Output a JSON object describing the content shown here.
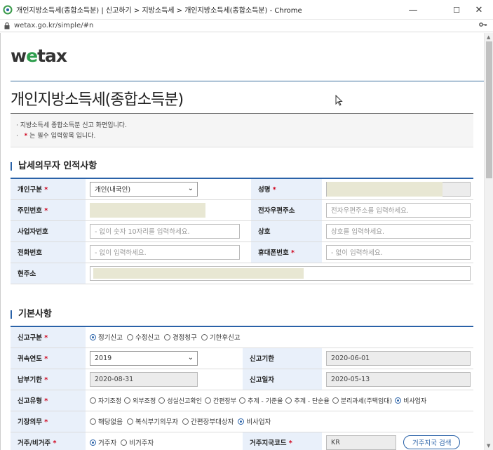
{
  "window": {
    "title": "개인지방소득세(종합소득분) | 신고하기 > 지방소득세 > 개인지방소득세(종합소득분) - Chrome",
    "url": "wetax.go.kr/simple/#n",
    "minimize": "—",
    "maximize": "☐",
    "close": "✕"
  },
  "logo": {
    "w": "w",
    "e": "e",
    "tax": "tax"
  },
  "page_title": "개인지방소득세(종합소득분)",
  "notice": {
    "line1": "· 지방소득세 종합소득분 신고 화면입니다.",
    "line2_prefix": "·",
    "line2_suffix": "는 필수 입력항목 입니다."
  },
  "required_mark": "*",
  "section1": {
    "title": "납세의무자 인적사항",
    "personal_type_label": "개인구분",
    "personal_type_value": "개인(내국인)",
    "name_label": "성명",
    "rrn_label": "주민번호",
    "email_label": "전자우편주소",
    "email_placeholder": "전자우편주소를 입력하세요.",
    "bizno_label": "사업자번호",
    "bizno_placeholder": "- 없이 숫자 10자리를 입력하세요.",
    "trade_name_label": "상호",
    "trade_name_placeholder": "상호를 입력하세요.",
    "phone_label": "전화번호",
    "phone_placeholder": "- 없이 입력하세요.",
    "mobile_label": "휴대폰번호",
    "mobile_placeholder": "- 없이 입력하세요.",
    "address_label": "현주소"
  },
  "section2": {
    "title": "기본사항",
    "report_type_label": "신고구분",
    "report_type_options": [
      "정기신고",
      "수정신고",
      "경정청구",
      "기한후신고"
    ],
    "report_type_selected": "정기신고",
    "year_label": "귀속연도",
    "year_value": "2019",
    "deadline_label": "신고기한",
    "deadline_value": "2020-06-01",
    "pay_deadline_label": "납부기한",
    "pay_deadline_value": "2020-08-31",
    "report_date_label": "신고일자",
    "report_date_value": "2020-05-13",
    "report_kind_label": "신고유형",
    "report_kind_options": [
      "자기조정",
      "외부조정",
      "성실신고확인",
      "간편장부",
      "추계 - 기준율",
      "추계 - 단순율",
      "분리과세(주택임대)",
      "비사업자"
    ],
    "report_kind_selected": "비사업자",
    "bookkeeping_label": "기장의무",
    "bookkeeping_options": [
      "해당없음",
      "복식부기의무자",
      "간편장부대상자",
      "비사업자"
    ],
    "bookkeeping_selected": "비사업자",
    "residency_label": "거주/비거주",
    "residency_options": [
      "거주자",
      "비거주자"
    ],
    "residency_selected": "거주자",
    "country_code_label": "거주지국코드",
    "country_code_value": "KR",
    "country_search_button": "거주지국 검색"
  }
}
